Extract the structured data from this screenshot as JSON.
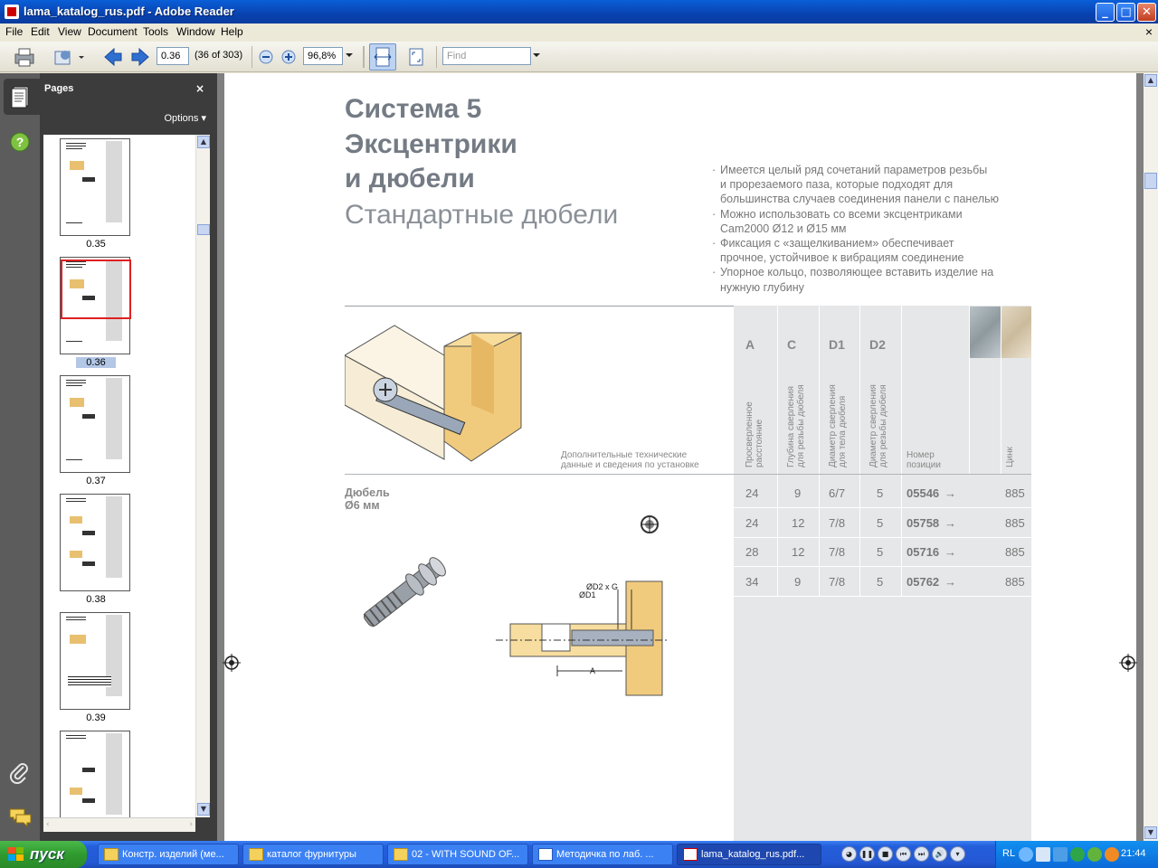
{
  "window": {
    "title": "lama_katalog_rus.pdf - Adobe Reader",
    "buttons": {
      "minimize": "_",
      "maximize": "□",
      "close": "✕"
    }
  },
  "menu": [
    "File",
    "Edit",
    "View",
    "Document",
    "Tools",
    "Window",
    "Help"
  ],
  "menu_close": "×",
  "toolbar": {
    "page_input": "0.36",
    "page_count": "(36 of 303)",
    "zoom": "96,8%",
    "find_placeholder": "Find"
  },
  "pages_panel": {
    "title": "Pages",
    "close": "×",
    "options_label": "Options",
    "thumbnails": [
      {
        "label": "0.35",
        "selected": false
      },
      {
        "label": "0.36",
        "selected": true
      },
      {
        "label": "0.37",
        "selected": false
      },
      {
        "label": "0.38",
        "selected": false
      },
      {
        "label": "0.39",
        "selected": false
      }
    ]
  },
  "document": {
    "title_lines": [
      "Система 5",
      "Эксцентрики",
      "и дюбели"
    ],
    "subtitle": "Стандартные дюбели",
    "bullets": [
      [
        "Имеется целый ряд сочетаний параметров резьбы",
        "и прорезаемого паза, которые подходят для",
        "большинства случаев соединения панели с панелью"
      ],
      [
        "Можно использовать со всеми эксцентриками",
        "Cam2000 Ø12 и Ø15 мм"
      ],
      [
        "Фиксация с «защелкиванием» обеспечивает",
        "прочное, устойчивое к вибрациям соединение"
      ],
      [
        "Упорное кольцо, позволяющее вставить изделие на",
        "нужную глубину"
      ]
    ],
    "extra_note": [
      "Дополнительные технические",
      "данные и сведения по установке"
    ],
    "product_title": [
      "Дюбель",
      "Ø6 мм"
    ],
    "diagram_labels": {
      "d2g": "ØD2 x G",
      "d1": "ØD1",
      "a": "A"
    },
    "table": {
      "col_letters": [
        "A",
        "C",
        "D1",
        "D2"
      ],
      "col_descriptions": [
        [
          "Просверленное",
          "расстояние"
        ],
        [
          "Глубина сверления",
          "для резьбы дюбеля"
        ],
        [
          "Диаметр сверления",
          "для тела дюбеля"
        ],
        [
          "Диаметр сверления",
          "для резьбы дюбеля"
        ]
      ],
      "position_header": [
        "Номер",
        "позиции"
      ],
      "finish_header": "Цинк",
      "rows": [
        {
          "a": "24",
          "c": "9",
          "d1": "6/7",
          "d2": "5",
          "pos": "05546",
          "arrow": "→",
          "zinc": "885"
        },
        {
          "a": "24",
          "c": "12",
          "d1": "7/8",
          "d2": "5",
          "pos": "05758",
          "arrow": "→",
          "zinc": "885"
        },
        {
          "a": "28",
          "c": "12",
          "d1": "7/8",
          "d2": "5",
          "pos": "05716",
          "arrow": "→",
          "zinc": "885"
        },
        {
          "a": "34",
          "c": "9",
          "d1": "7/8",
          "d2": "5",
          "pos": "05762",
          "arrow": "→",
          "zinc": "885"
        }
      ]
    }
  },
  "taskbar": {
    "start_label": "пуск",
    "tasks": [
      {
        "label": "Констр. изделий (ме...",
        "active": false
      },
      {
        "label": "каталог фурнитуры",
        "active": false
      },
      {
        "label": "02 - WITH SOUND OF...",
        "active": false
      },
      {
        "label": "Методичка по лаб. ...",
        "active": false
      },
      {
        "label": "lama_katalog_rus.pdf...",
        "active": true
      }
    ],
    "language": "RL",
    "clock": "21:44"
  },
  "colors": {
    "title_grey": "#747b84",
    "table_bg": "#e6e7e8",
    "wood": "#e8c070",
    "xp_blue": "#245edb",
    "start_green": "#2f9a2e"
  }
}
